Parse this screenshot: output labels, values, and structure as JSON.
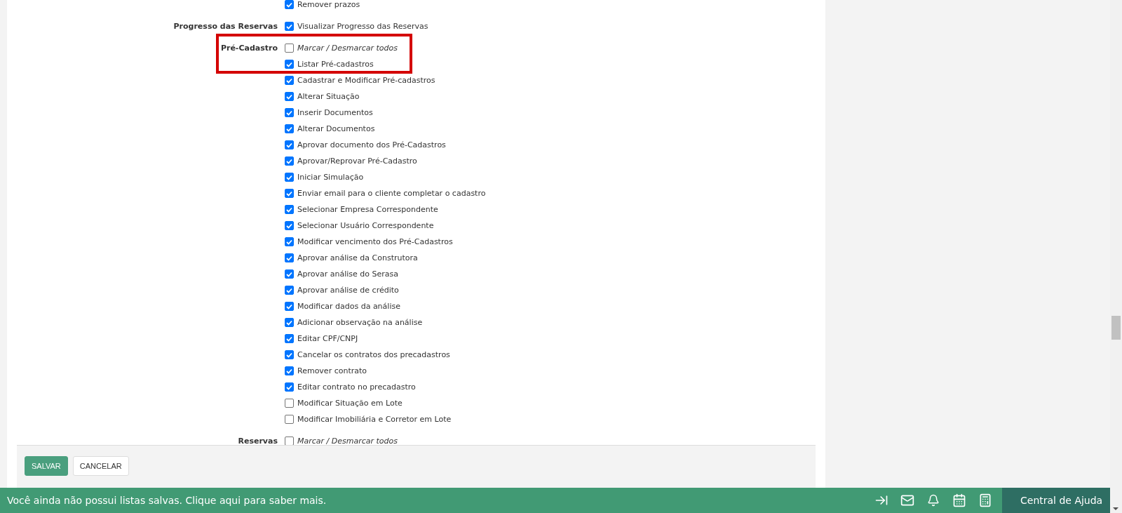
{
  "permission_groups": [
    {
      "items": [
        {
          "kind": "permission",
          "text": "Remover prazos",
          "checked": true
        }
      ]
    },
    {
      "label": "Progresso das Reservas",
      "items": [
        {
          "kind": "permission",
          "text": "Visualizar Progresso das Reservas",
          "checked": true
        }
      ]
    },
    {
      "label": "Pré-Cadastro",
      "highlighted": true,
      "items": [
        {
          "kind": "toggle-all",
          "text": "Marcar / Desmarcar todos",
          "checked": false
        },
        {
          "kind": "permission",
          "text": "Listar Pré-cadastros",
          "checked": true
        },
        {
          "kind": "permission",
          "text": "Cadastrar e Modificar Pré-cadastros",
          "checked": true
        },
        {
          "kind": "permission",
          "text": "Alterar Situação",
          "checked": true
        },
        {
          "kind": "permission",
          "text": "Inserir Documentos",
          "checked": true
        },
        {
          "kind": "permission",
          "text": "Alterar Documentos",
          "checked": true
        },
        {
          "kind": "permission",
          "text": "Aprovar documento dos Pré-Cadastros",
          "checked": true
        },
        {
          "kind": "permission",
          "text": "Aprovar/Reprovar Pré-Cadastro",
          "checked": true
        },
        {
          "kind": "permission",
          "text": "Iniciar Simulação",
          "checked": true
        },
        {
          "kind": "permission",
          "text": "Enviar email para o cliente completar o cadastro",
          "checked": true
        },
        {
          "kind": "permission",
          "text": "Selecionar Empresa Correspondente",
          "checked": true
        },
        {
          "kind": "permission",
          "text": "Selecionar Usuário Correspondente",
          "checked": true
        },
        {
          "kind": "permission",
          "text": "Modificar vencimento dos Pré-Cadastros",
          "checked": true
        },
        {
          "kind": "permission",
          "text": "Aprovar análise da Construtora",
          "checked": true
        },
        {
          "kind": "permission",
          "text": "Aprovar análise do Serasa",
          "checked": true
        },
        {
          "kind": "permission",
          "text": "Aprovar análise de crédito",
          "checked": true
        },
        {
          "kind": "permission",
          "text": "Modificar dados da análise",
          "checked": true
        },
        {
          "kind": "permission",
          "text": "Adicionar observação na análise",
          "checked": true
        },
        {
          "kind": "permission",
          "text": "Editar CPF/CNPJ",
          "checked": true
        },
        {
          "kind": "permission",
          "text": "Cancelar os contratos dos precadastros",
          "checked": true
        },
        {
          "kind": "permission",
          "text": "Remover contrato",
          "checked": true
        },
        {
          "kind": "permission",
          "text": "Editar contrato no precadastro",
          "checked": true
        },
        {
          "kind": "permission",
          "text": "Modificar Situação em Lote",
          "checked": false
        },
        {
          "kind": "permission",
          "text": "Modificar Imobiliária e Corretor em Lote",
          "checked": false
        }
      ]
    },
    {
      "label": "Reservas",
      "items": [
        {
          "kind": "toggle-all",
          "text": "Marcar / Desmarcar todos",
          "checked": false
        }
      ]
    }
  ],
  "form_buttons": [
    {
      "kind": "primary",
      "label": "SALVAR"
    },
    {
      "kind": "secondary",
      "label": "CANCELAR"
    }
  ],
  "bottom_bar": {
    "message": "Você ainda não possui listas salvas. Clique aqui para saber mais.",
    "help_label": "Central de Ajuda"
  }
}
